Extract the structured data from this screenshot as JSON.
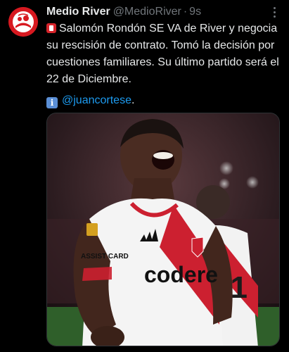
{
  "author": {
    "name": "Medio River",
    "handle": "@MedioRiver",
    "separator": "·",
    "time": "9s"
  },
  "tweet": {
    "line1": "Salomón Rondón SE VA de River y negocia su rescisión de contrato. Tomó la decisión por cuestiones familiares. Su último partido será el 22 de Diciembre.",
    "info_glyph": "i",
    "mention": "@juancortese",
    "mention_suffix": "."
  },
  "media": {
    "sponsor_text": "codere",
    "sleeve_text": "ASSIST CARD",
    "number_text": "21"
  },
  "icons": {
    "more": "more-horizontal-icon",
    "red_square": "red-square-emoji-icon",
    "info": "information-emoji-icon"
  },
  "colors": {
    "background": "#000000",
    "text": "#e7e9ea",
    "muted": "#71767b",
    "link": "#1d9bf0",
    "brand_red": "#d71920"
  }
}
